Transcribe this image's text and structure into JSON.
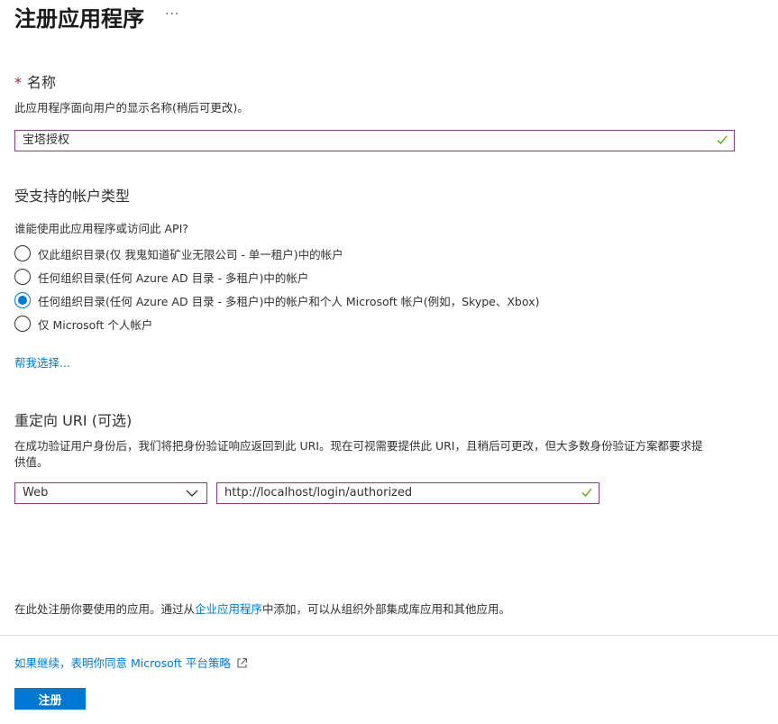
{
  "header": {
    "title": "注册应用程序",
    "more_label": "···"
  },
  "name_section": {
    "required_mark": "*",
    "label": "名称",
    "description": "此应用程序面向用户的显示名称(稍后可更改)。",
    "value": "宝塔授权"
  },
  "account_types": {
    "heading": "受支持的帐户类型",
    "question": "谁能使用此应用程序或访问此 API?",
    "options": [
      {
        "label": "仅此组织目录(仅 我鬼知道矿业无限公司 - 单一租户)中的帐户",
        "checked": false
      },
      {
        "label": "任何组织目录(任何 Azure AD 目录 - 多租户)中的帐户",
        "checked": false
      },
      {
        "label": "任何组织目录(任何 Azure AD 目录 - 多租户)中的帐户和个人 Microsoft 帐户(例如，Skype、Xbox)",
        "checked": true
      },
      {
        "label": "仅 Microsoft 个人帐户",
        "checked": false
      }
    ],
    "help_link": "帮我选择..."
  },
  "redirect": {
    "heading": "重定向 URI (可选)",
    "description_line1": "在成功验证用户身份后，我们将把身份验证响应返回到此 URI。现在可视需要提供此 URI，且稍后可更改，但大多数身份验证方案都要求提",
    "description_line2": "供值。",
    "platform_value": "Web",
    "uri_value": "http://localhost/login/authorized"
  },
  "footer": {
    "note_prefix": "在此处注册你要使用的应用。通过从",
    "note_link": "企业应用程序",
    "note_suffix": "中添加，可以从组织外部集成库应用和其他应用。",
    "policy_link": "如果继续，表明你同意 Microsoft 平台策略",
    "register_label": "注册"
  },
  "colors": {
    "accent": "#0078d4",
    "input_border": "#8a3a8a",
    "valid_check": "#57a300",
    "required": "#a4262c"
  }
}
